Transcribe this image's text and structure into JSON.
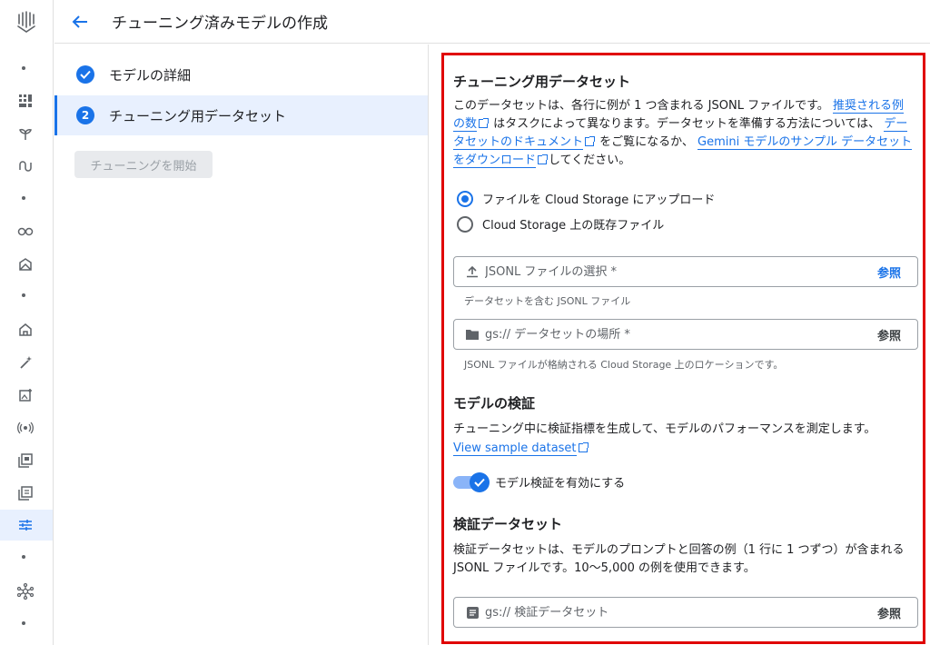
{
  "header": {
    "title": "チューニング済みモデルの作成"
  },
  "stepper": {
    "steps": [
      {
        "number": "",
        "label": "モデルの詳細",
        "state": "done"
      },
      {
        "number": "2",
        "label": "チューニング用データセット",
        "state": "active"
      }
    ],
    "start_button": "チューニングを開始"
  },
  "dataset": {
    "heading": "チューニング用データセット",
    "desc_1": "このデータセットは、各行に例が 1 つ含まれる JSONL ファイルです。",
    "link_recommended": "推奨される例の数",
    "desc_2": "はタスクによって異なります。データセットを準備する方法については、",
    "link_docs": "データセットのドキュメント",
    "desc_3": "をご覧になるか、",
    "link_gemini": "Gemini モデルのサンプル データセットをダウンロード",
    "desc_4": "してください。",
    "radio_upload": "ファイルを Cloud Storage にアップロード",
    "radio_existing": "Cloud Storage 上の既存ファイル",
    "upload_placeholder": "JSONL ファイルの選択 *",
    "upload_browse": "参照",
    "upload_hint": "データセットを含む JSONL ファイル",
    "location_placeholder": "gs:// データセットの場所 *",
    "location_browse": "参照",
    "location_hint": "JSONL ファイルが格納される Cloud Storage 上のロケーションです。"
  },
  "validation": {
    "heading": "モデルの検証",
    "desc": "チューニング中に検証指標を生成して、モデルのパフォーマンスを測定します。",
    "link_sample": "View sample dataset",
    "toggle_label": "モデル検証を有効にする",
    "toggle_on": true
  },
  "validation_dataset": {
    "heading": "検証データセット",
    "desc": "検証データセットは、モデルのプロンプトと回答の例（1 行に 1 つずつ）が含まれる JSONL ファイルです。10～5,000 の例を使用できます。",
    "placeholder": "gs:// 検証データセット",
    "browse": "参照"
  },
  "colors": {
    "accent": "#1a73e8",
    "highlight_border": "#e00000",
    "active_step_bg": "#e8f0fe"
  }
}
